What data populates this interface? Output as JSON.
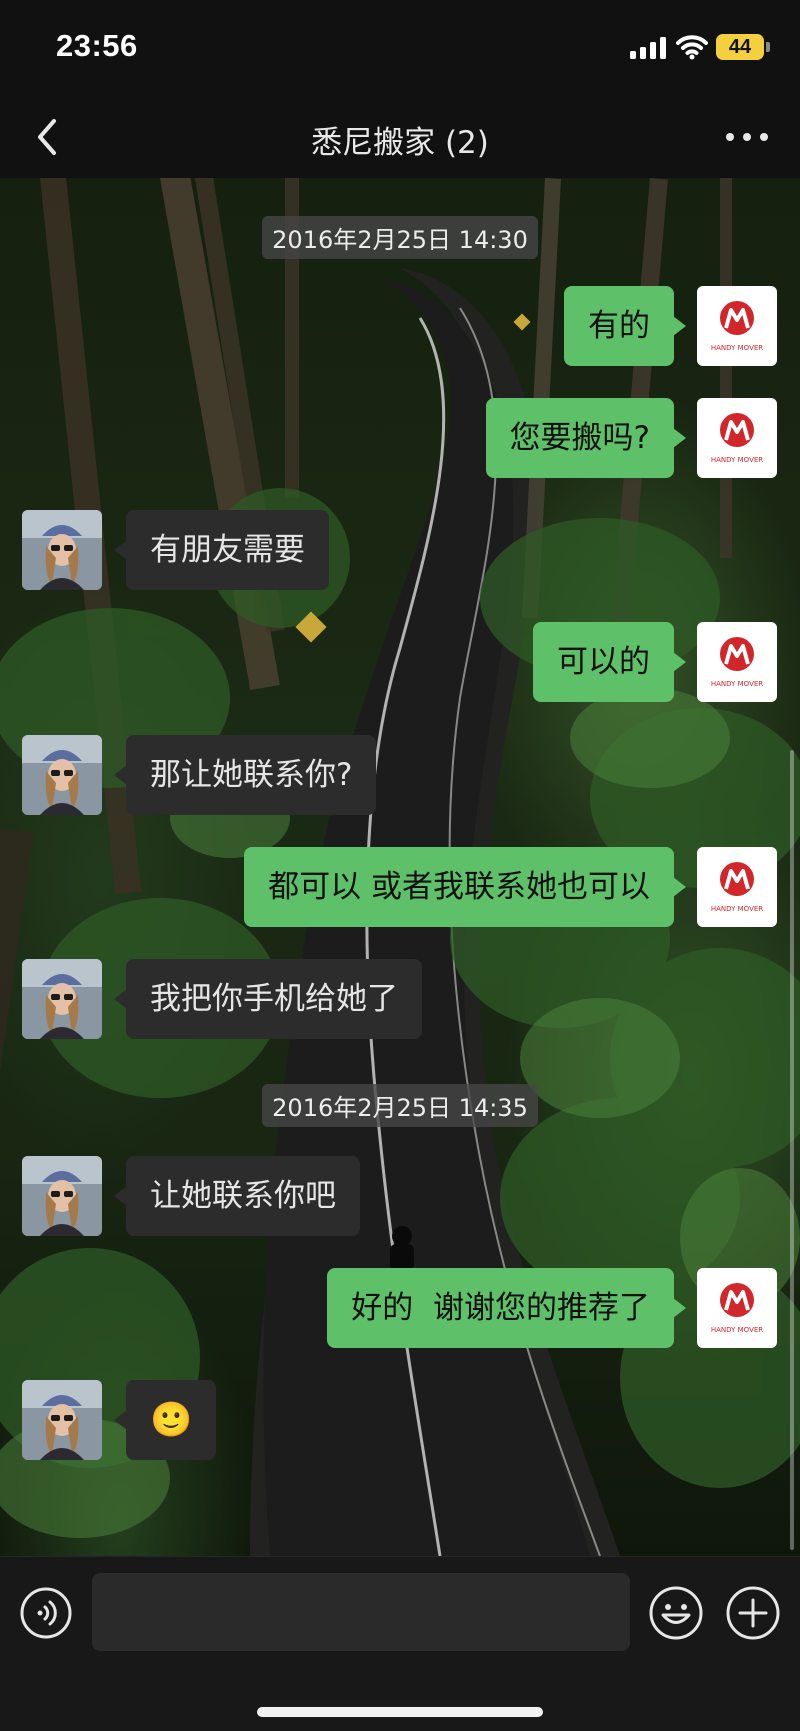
{
  "status_bar": {
    "time": "23:56",
    "battery": "44"
  },
  "header": {
    "title": "悉尼搬家 (2)"
  },
  "messages": [
    {
      "type": "timestamp",
      "text": "2016年2月25日 14:30"
    },
    {
      "type": "out",
      "text": "有的"
    },
    {
      "type": "out",
      "text": "您要搬吗?"
    },
    {
      "type": "in",
      "text": "有朋友需要"
    },
    {
      "type": "out",
      "text": "可以的"
    },
    {
      "type": "in",
      "text": "那让她联系你?"
    },
    {
      "type": "out",
      "text": "都可以 或者我联系她也可以"
    },
    {
      "type": "in",
      "text": "我把你手机给她了"
    },
    {
      "type": "timestamp",
      "text": "2016年2月25日 14:35"
    },
    {
      "type": "in",
      "text": "让她联系你吧"
    },
    {
      "type": "out",
      "text": "好的  谢谢您的推荐了"
    },
    {
      "type": "in",
      "text": "🙂"
    }
  ],
  "company_logo_text": "HANDY MOVER",
  "colors": {
    "accent_green": "#5ec16a",
    "incoming_bubble": "#2c2c2c",
    "battery": "#f4d03f"
  },
  "icons": {
    "back": "chevron-left-icon",
    "more": "more-dots-icon",
    "voice": "voice-icon",
    "emoji": "emoji-icon",
    "plus": "plus-icon"
  }
}
